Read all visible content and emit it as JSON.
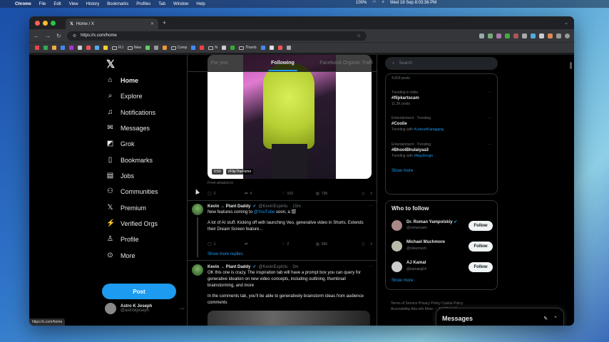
{
  "menubar": {
    "app": "Chrome",
    "items": [
      "File",
      "Edit",
      "View",
      "History",
      "Bookmarks",
      "Profiles",
      "Tab",
      "Window",
      "Help"
    ],
    "battery": "100%",
    "datetime": "Wed 18 Sep  8:03:36 PM"
  },
  "browser": {
    "tab_title": "Home / X",
    "url": "https://x.com/home",
    "status_url": "https://x.com/home",
    "bookmarks": [
      "FIJ",
      "New",
      "Comp",
      "N",
      "Thumb"
    ]
  },
  "leftnav": {
    "items": [
      {
        "label": "Home",
        "icon": "home-icon"
      },
      {
        "label": "Explore",
        "icon": "search-icon"
      },
      {
        "label": "Notifications",
        "icon": "bell-icon"
      },
      {
        "label": "Messages",
        "icon": "envelope-icon"
      },
      {
        "label": "Grok",
        "icon": "grok-icon"
      },
      {
        "label": "Bookmarks",
        "icon": "bookmark-icon"
      },
      {
        "label": "Jobs",
        "icon": "briefcase-icon"
      },
      {
        "label": "Communities",
        "icon": "people-icon"
      },
      {
        "label": "Premium",
        "icon": "x-icon"
      },
      {
        "label": "Verified Orgs",
        "icon": "lightning-icon"
      },
      {
        "label": "Profile",
        "icon": "person-icon"
      },
      {
        "label": "More",
        "icon": "more-circle-icon"
      }
    ],
    "post_label": "Post",
    "account_name": "Astro K Joseph",
    "account_handle": "@astrokjoseph"
  },
  "timeline": {
    "tabs": [
      "For you",
      "Following",
      "Facebook Organic Traffi"
    ],
    "active_tab": "Following",
    "video_time": "0:50",
    "video_tag": "#FlipTheFomo",
    "from_text": "From amazon.in",
    "post0_stats": {
      "replies": "2",
      "reposts": "4",
      "likes": "103",
      "views": "73K"
    },
    "tweet1": {
      "name": "Kevin → Plant Daddy",
      "handle": "@KevinEspiritu",
      "time": "· 15m",
      "line1_pre": "New features coming to ",
      "line1_link": "@YouTube",
      "line1_post": " soon, a 🎬",
      "para2": "A lot of AI stuff. Kicking off with launching Veo, generative video in Shorts. Extends their Dream Screen feature...",
      "stats": {
        "replies": "1",
        "reposts": "",
        "likes": "2",
        "views": "590"
      }
    },
    "show_more_replies": "Show more replies",
    "tweet2": {
      "name": "Kevin → Plant Daddy",
      "handle": "@KevinEspiritu",
      "time": "· 3m",
      "para1": "OK this one is crazy. The inspiration tab will have a prompt box you can query for generative ideation on new video concepts, including outlining, thumbnail brainstorming, and more",
      "para2": "In the comments tab, you'll be able to generatively brainstorm ideas from audience comments"
    }
  },
  "rightcol": {
    "search_placeholder": "Search",
    "trends": [
      {
        "meta": "",
        "title": "",
        "sub": "4,829 posts"
      },
      {
        "meta": "Trending in India",
        "title": "#flipkartscam",
        "sub": "11.3K posts"
      },
      {
        "meta": "Entertainment · Trending",
        "title": "#Coolie",
        "sub_pre": "Trending with ",
        "sub_link": "#LokeshKanagaraj"
      },
      {
        "meta": "Entertainment · Trending",
        "title": "#BhoolBhulaiyaa3",
        "sub_pre": "Trending with ",
        "sub_link": "#AjayDevgn"
      }
    ],
    "show_more": "Show more",
    "who_to_follow": "Who to follow",
    "follow_suggestions": [
      {
        "name": "Dr. Roman Yampolskiy",
        "handle": "@romanyam",
        "btn": "Follow"
      },
      {
        "name": "Michael Muchmore",
        "handle": "@mikemuch",
        "btn": "Follow"
      },
      {
        "name": "AJ Kamal",
        "handle": "@kamalaj64",
        "btn": "Follow"
      }
    ],
    "show_more_2": "Show more",
    "footer_line1": "Terms of Service   Privacy Policy   Cookie Policy",
    "footer_line2": "Accessibility   Ads info   More ···   © 2024 X Corp."
  },
  "messages_drawer": {
    "title": "Messages"
  },
  "colors": {
    "accent": "#1d9bf0",
    "bg": "#000000",
    "border": "#2f3336"
  }
}
